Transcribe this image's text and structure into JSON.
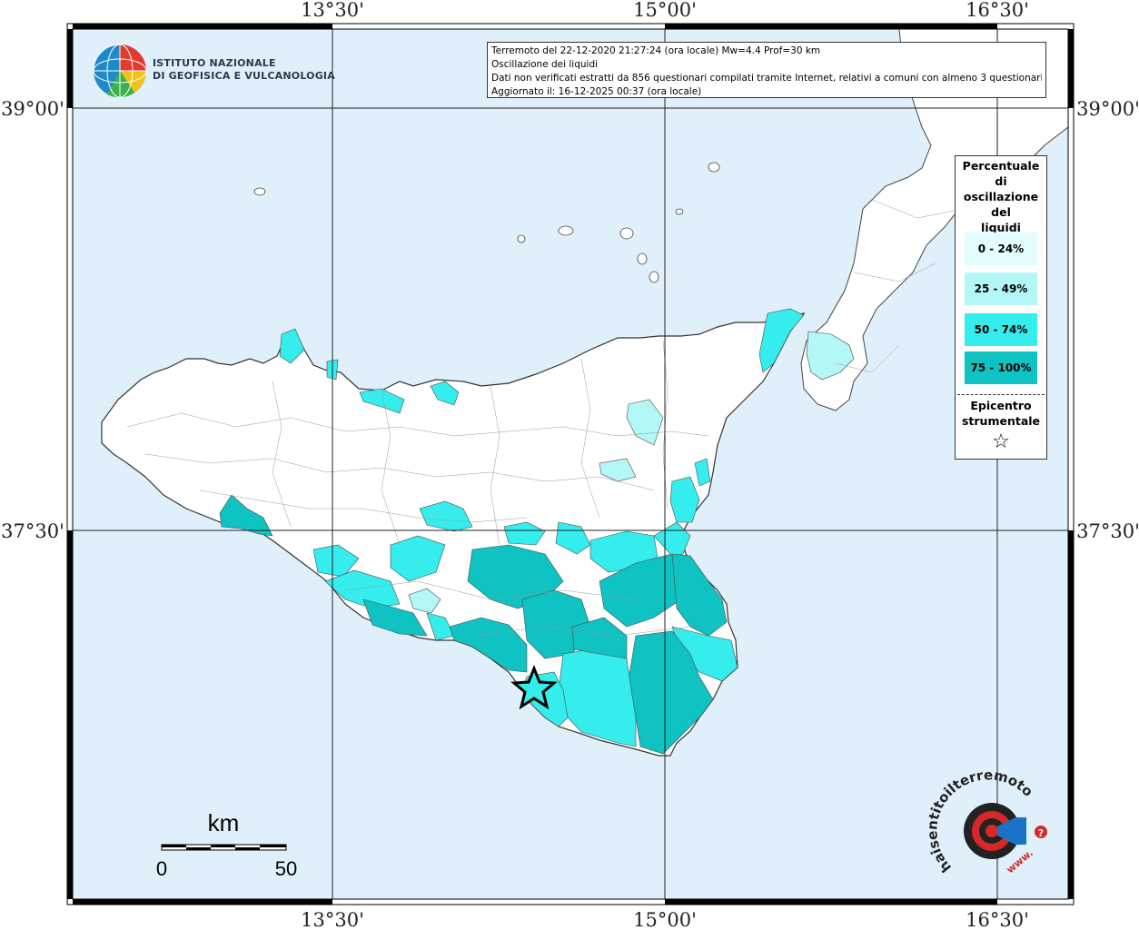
{
  "header": {
    "line1": "Terremoto del 22-12-2020 21:27:24 (ora locale) Mw=4.4 Prof=30 km",
    "line2": "Oscillazione dei liquidi",
    "line3": "Dati non verificati estratti da 856 questionari compilati tramite Internet, relativi a comuni con almeno 3 questionari.",
    "line4": "Aggiornato il: 16-12-2025 00:37 (ora locale)"
  },
  "institute": {
    "line1": "ISTITUTO NAZIONALE",
    "line2": "DI GEOFISICA E VULCANOLOGIA"
  },
  "coordinates": {
    "top": [
      "13°30'",
      "15°00'",
      "16°30'"
    ],
    "bottom": [
      "13°30'",
      "15°00'",
      "16°30'"
    ],
    "left": [
      "39°00'",
      "37°30'"
    ],
    "right": [
      "39°00'",
      "37°30'"
    ]
  },
  "legend": {
    "title_lines": [
      "Percentuale",
      "di",
      "oscillazione",
      "del",
      "liquidi"
    ],
    "items": [
      {
        "label": "0 - 24%",
        "color": "#e3fdfd"
      },
      {
        "label": "25 - 49%",
        "color": "#b4f7f7"
      },
      {
        "label": "50 - 74%",
        "color": "#35eded"
      },
      {
        "label": "75 - 100%",
        "color": "#0fc3c3"
      }
    ],
    "epicenter_lines": [
      "Epicentro",
      "strumentale"
    ],
    "epicenter_symbol": "☆"
  },
  "scalebar": {
    "unit": "km",
    "start": "0",
    "end": "50"
  },
  "hsit_logo": {
    "text_main": "haisentitoilterremoto.it",
    "text_www": "www."
  },
  "colors": {
    "sea": "#e0f0fb",
    "land": "#ffffff",
    "border": "#333333"
  }
}
